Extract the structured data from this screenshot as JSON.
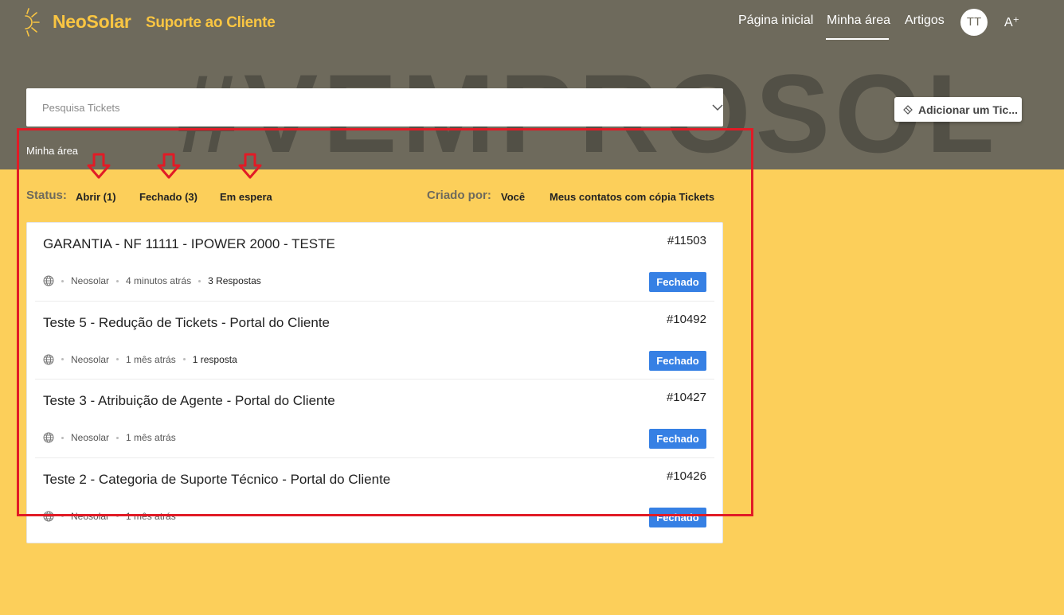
{
  "header": {
    "brand": "NeoSolar",
    "subbrand": "Suporte ao Cliente",
    "watermark": "#VEMPROSOL",
    "nav": [
      {
        "label": "Página inicial"
      },
      {
        "label": "Minha área",
        "active": true
      },
      {
        "label": "Artigos"
      }
    ],
    "avatar_initials": "TT",
    "font_size_icon": "A⁺",
    "colors": {
      "brand": "#f9c542",
      "hero": "#6e6a5c"
    }
  },
  "search": {
    "placeholder": "Pesquisa Tickets",
    "chevron_icon": "chevron-down-icon"
  },
  "add_ticket": {
    "label": "Adicionar um Tic...",
    "icon": "ticket-icon"
  },
  "breadcrumb": "Minha área",
  "filters": {
    "status_label": "Status:",
    "status_options": [
      "Abrir (1)",
      "Fechado (3)",
      "Em espera"
    ],
    "created_label": "Criado por:",
    "created_options": [
      "Você",
      "Meus contatos com cópia Tickets"
    ]
  },
  "tickets": [
    {
      "title": "GARANTIA - NF 11111 - IPOWER 2000 - TESTE",
      "id": "#11503",
      "company": "Neosolar",
      "time": "4 minutos atrás",
      "replies": "3 Respostas",
      "status": "Fechado"
    },
    {
      "title": "Teste 5 - Redução de Tickets - Portal do Cliente",
      "id": "#10492",
      "company": "Neosolar",
      "time": "1 mês atrás",
      "replies": "1 resposta",
      "status": "Fechado"
    },
    {
      "title": "Teste 3 - Atribuição de Agente - Portal do Cliente",
      "id": "#10427",
      "company": "Neosolar",
      "time": "1 mês atrás",
      "replies": "",
      "status": "Fechado"
    },
    {
      "title": "Teste 2 - Categoria de Suporte Técnico - Portal do Cliente",
      "id": "#10426",
      "company": "Neosolar",
      "time": "1 mês atrás",
      "replies": "",
      "status": "Fechado"
    }
  ],
  "annotation_color": "#e11b26",
  "status_color": "#3680e4"
}
